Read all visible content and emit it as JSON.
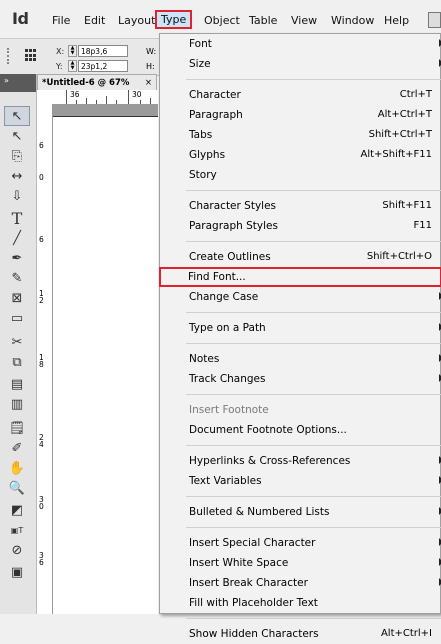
{
  "app": {
    "logo": "Id"
  },
  "menubar": {
    "items": [
      "File",
      "Edit",
      "Layout",
      "Type",
      "Object",
      "Table",
      "View",
      "Window",
      "Help"
    ]
  },
  "control": {
    "x_label": "X:",
    "x_value": "18p3,6",
    "y_label": "Y:",
    "y_value": "23p1,2",
    "w_label": "W:",
    "h_label": "H:"
  },
  "document": {
    "tab_title": "*Untitled-6 @ 67%",
    "close": "×",
    "hruler": [
      "36",
      "30"
    ],
    "vruler": [
      "6",
      "0",
      "6",
      "12",
      "18",
      "24",
      "30",
      "36"
    ]
  },
  "type_menu": {
    "groups": [
      [
        {
          "label": "Font",
          "shortcut": "",
          "submenu": true
        },
        {
          "label": "Size",
          "shortcut": "",
          "submenu": true
        }
      ],
      [
        {
          "label": "Character",
          "shortcut": "Ctrl+T"
        },
        {
          "label": "Paragraph",
          "shortcut": "Alt+Ctrl+T"
        },
        {
          "label": "Tabs",
          "shortcut": "Shift+Ctrl+T"
        },
        {
          "label": "Glyphs",
          "shortcut": "Alt+Shift+F11"
        },
        {
          "label": "Story",
          "shortcut": ""
        }
      ],
      [
        {
          "label": "Character Styles",
          "shortcut": "Shift+F11"
        },
        {
          "label": "Paragraph Styles",
          "shortcut": "F11"
        }
      ],
      [
        {
          "label": "Create Outlines",
          "shortcut": "Shift+Ctrl+O"
        },
        {
          "label": "Find Font...",
          "shortcut": "",
          "highlight": true
        },
        {
          "label": "Change Case",
          "shortcut": "",
          "submenu": true
        }
      ],
      [
        {
          "label": "Type on a Path",
          "shortcut": "",
          "submenu": true
        }
      ],
      [
        {
          "label": "Notes",
          "shortcut": "",
          "submenu": true
        },
        {
          "label": "Track Changes",
          "shortcut": "",
          "submenu": true
        }
      ],
      [
        {
          "label": "Insert Footnote",
          "shortcut": "",
          "disabled": true
        },
        {
          "label": "Document Footnote Options...",
          "shortcut": ""
        }
      ],
      [
        {
          "label": "Hyperlinks & Cross-References",
          "shortcut": "",
          "submenu": true
        },
        {
          "label": "Text Variables",
          "shortcut": "",
          "submenu": true
        }
      ],
      [
        {
          "label": "Bulleted & Numbered Lists",
          "shortcut": "",
          "submenu": true
        }
      ],
      [
        {
          "label": "Insert Special Character",
          "shortcut": "",
          "submenu": true
        },
        {
          "label": "Insert White Space",
          "shortcut": "",
          "submenu": true
        },
        {
          "label": "Insert Break Character",
          "shortcut": "",
          "submenu": true
        },
        {
          "label": "Fill with Placeholder Text",
          "shortcut": ""
        }
      ],
      [
        {
          "label": "Show Hidden Characters",
          "shortcut": "Alt+Ctrl+I"
        }
      ]
    ]
  },
  "colors": {
    "highlight_border": "#e0212e",
    "active_menu_bg": "#cce4f7"
  }
}
